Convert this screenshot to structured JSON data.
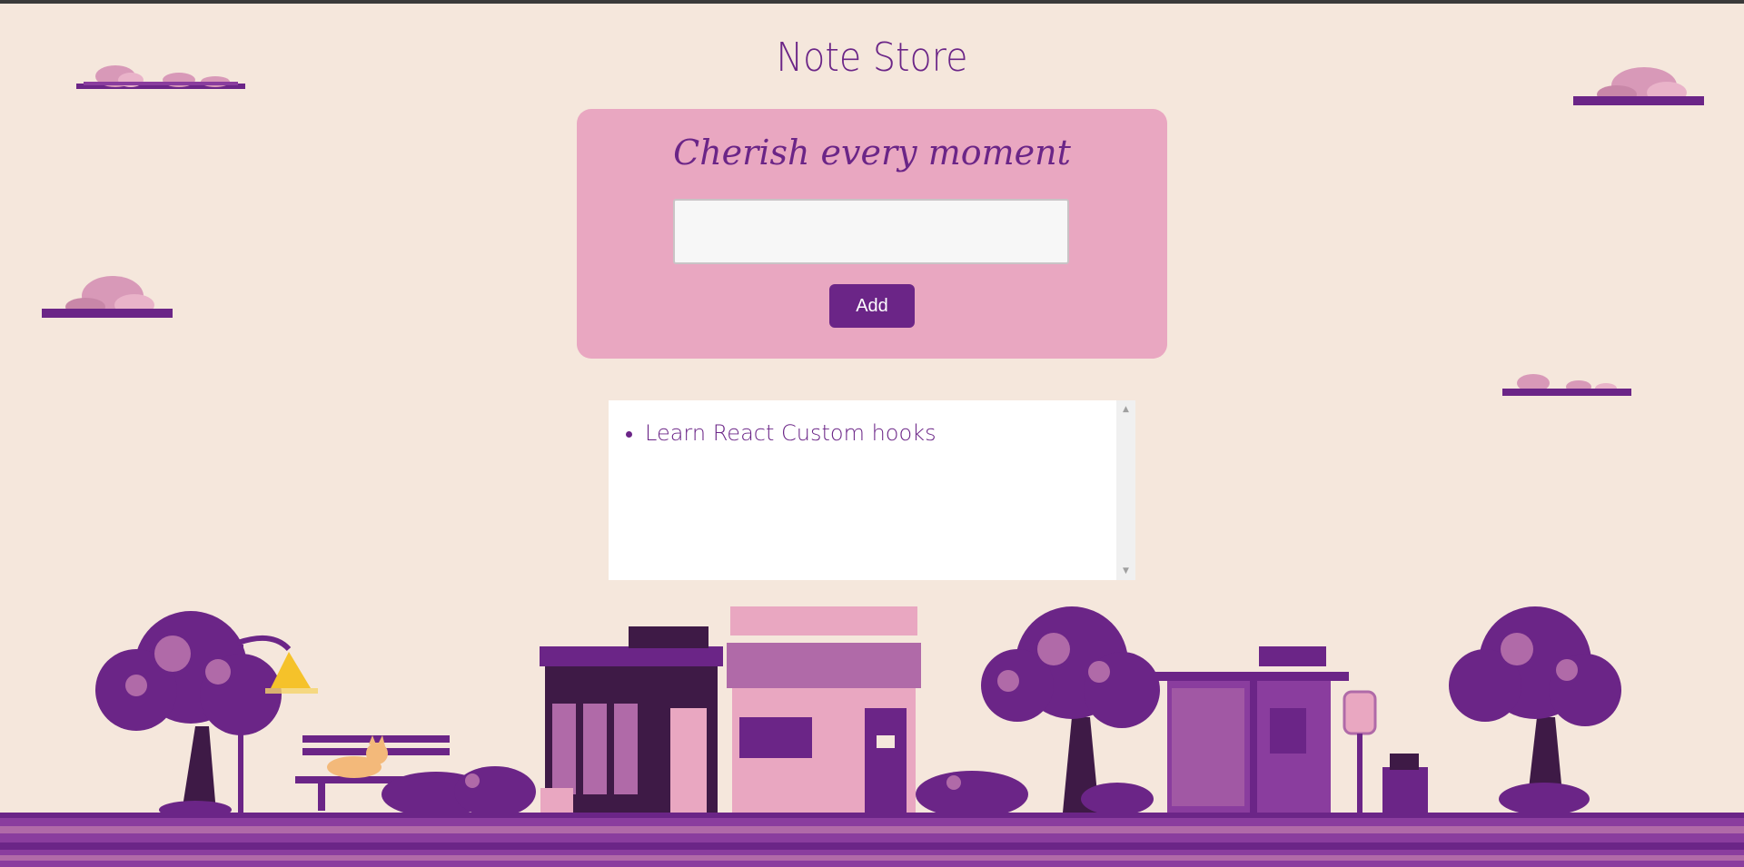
{
  "header": {
    "title": "Note Store"
  },
  "form": {
    "tagline": "Cherish every moment",
    "input_value": "",
    "input_placeholder": "",
    "add_label": "Add"
  },
  "notes": [
    {
      "text": "Learn React Custom hooks"
    }
  ],
  "colors": {
    "background": "#f5e7dc",
    "accent": "#6b2587",
    "card": "#e9a7c1"
  },
  "scene": {
    "icons": [
      "cloud-icon",
      "tree-icon",
      "street-lamp-icon",
      "bench-icon",
      "cat-icon",
      "shop-icon",
      "bakery-shop-icon",
      "bus-stop-icon",
      "bus-sign-icon",
      "trash-can-icon",
      "bush-icon",
      "pavement"
    ]
  }
}
